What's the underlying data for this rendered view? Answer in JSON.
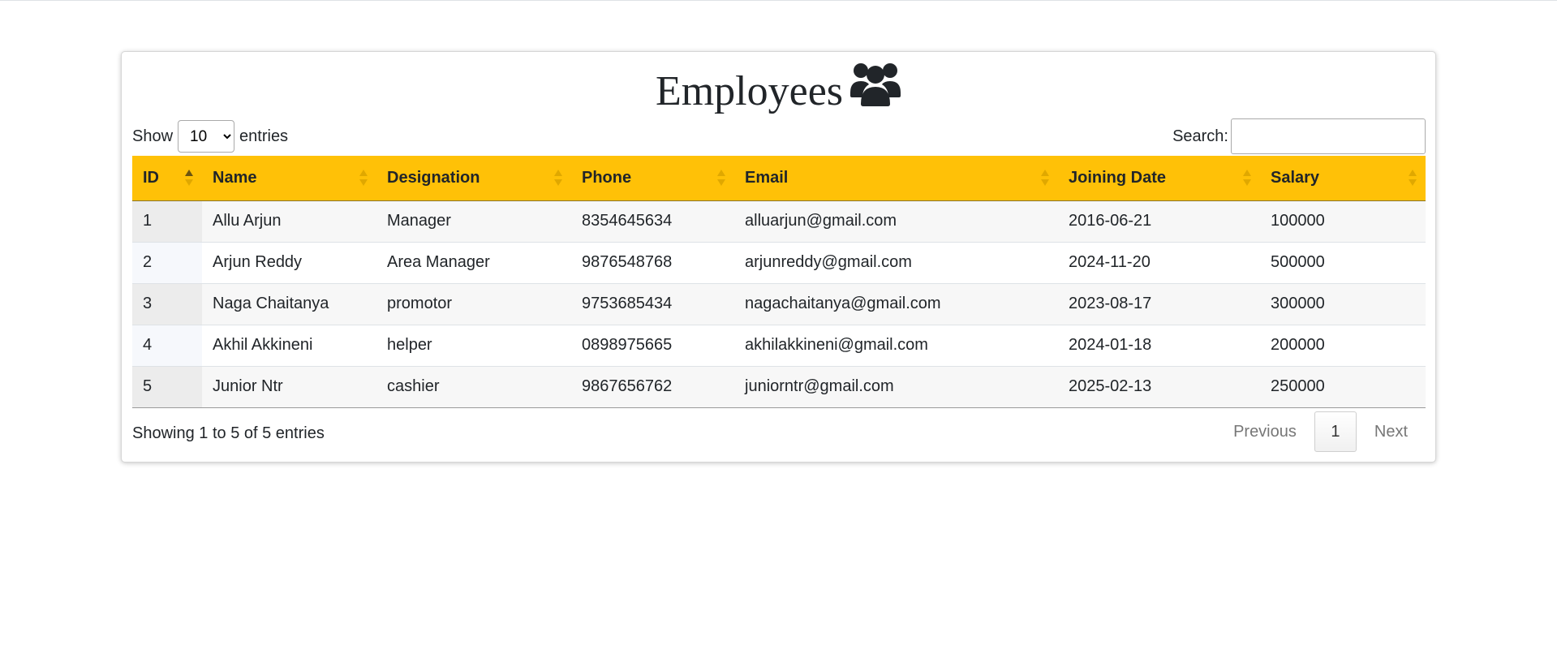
{
  "title": "Employees",
  "title_icon": "users-icon",
  "length": {
    "show": "Show",
    "value": "10",
    "entries": "entries",
    "options": [
      "10"
    ]
  },
  "search": {
    "label": "Search:",
    "value": ""
  },
  "columns": [
    {
      "label": "ID",
      "sort": "asc"
    },
    {
      "label": "Name",
      "sort": "none"
    },
    {
      "label": "Designation",
      "sort": "none"
    },
    {
      "label": "Phone",
      "sort": "none"
    },
    {
      "label": "Email",
      "sort": "none"
    },
    {
      "label": "Joining Date",
      "sort": "none"
    },
    {
      "label": "Salary",
      "sort": "none"
    }
  ],
  "rows": [
    [
      "1",
      "Allu Arjun",
      "Manager",
      "8354645634",
      "alluarjun@gmail.com",
      "2016-06-21",
      "100000"
    ],
    [
      "2",
      "Arjun Reddy",
      "Area Manager",
      "9876548768",
      "arjunreddy@gmail.com",
      "2024-11-20",
      "500000"
    ],
    [
      "3",
      "Naga Chaitanya",
      "promotor",
      "9753685434",
      "nagachaitanya@gmail.com",
      "2023-08-17",
      "300000"
    ],
    [
      "4",
      "Akhil Akkineni",
      "helper",
      "0898975665",
      "akhilakkineni@gmail.com",
      "2024-01-18",
      "200000"
    ],
    [
      "5",
      "Junior Ntr",
      "cashier",
      "9867656762",
      "juniorntr@gmail.com",
      "2025-02-13",
      "250000"
    ]
  ],
  "info": "Showing 1 to 5 of 5 entries",
  "pagination": {
    "previous": "Previous",
    "current": "1",
    "next": "Next"
  },
  "colors": {
    "header_bg": "#ffc107",
    "stripe": "#f7f7f7"
  }
}
